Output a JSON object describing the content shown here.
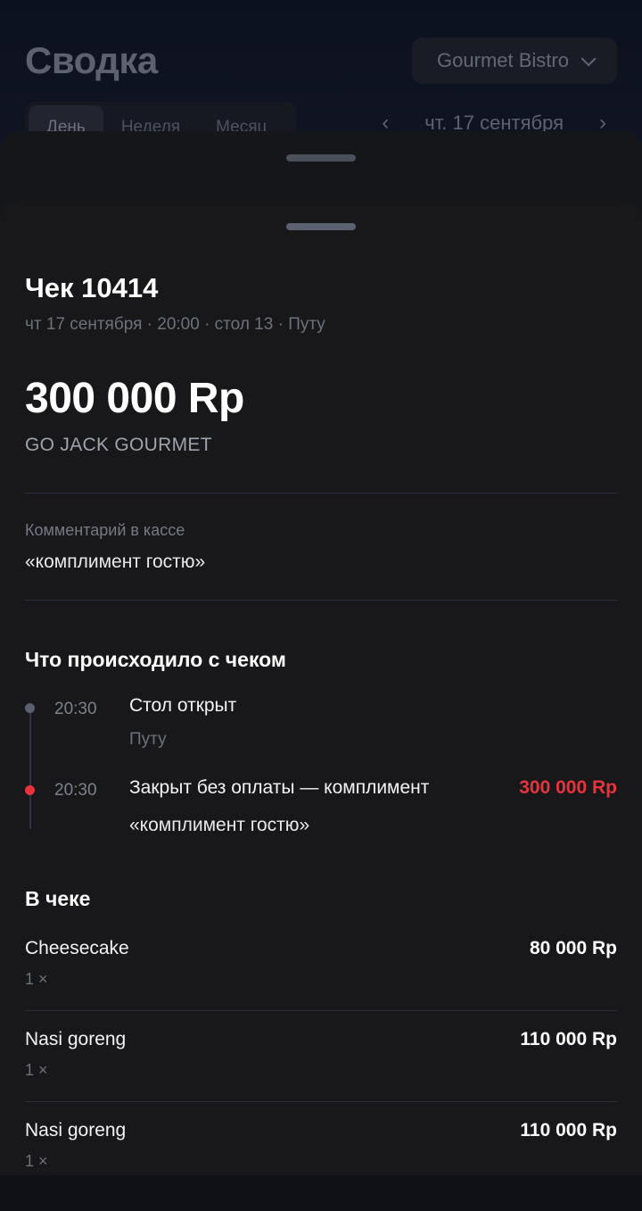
{
  "background": {
    "title": "Сводка",
    "venue": "Gourmet Bistro",
    "tabs": [
      "День",
      "Неделя",
      "Месяц"
    ],
    "active_tab": "День",
    "date": "чт. 17 сентября"
  },
  "check": {
    "title": "Чек 10414",
    "meta": "чт 17 сентября · 20:00 · стол 13 · Путу",
    "amount": "300 000 Rp",
    "payment_method": "GO JACK GOURMET",
    "comment_label": "Комментарий в кассе",
    "comment": "«комплимент гостю»"
  },
  "events": {
    "title": "Что происходило с чеком",
    "items": [
      {
        "time": "20:30",
        "title": "Стол открыт",
        "sub": "Путу",
        "amount": "",
        "dot_color": "#5b6070"
      },
      {
        "time": "20:30",
        "title": "Закрыт без оплаты — комплимент",
        "sub": "«комплимент гостю»",
        "amount": "300 000 Rp",
        "dot_color": "#e5343d"
      }
    ]
  },
  "items": {
    "title": "В чеке",
    "list": [
      {
        "name": "Cheesecake",
        "qty": "1 ×",
        "price": "80 000 Rp"
      },
      {
        "name": "Nasi goreng",
        "qty": "1 ×",
        "price": "110 000 Rp"
      },
      {
        "name": "Nasi goreng",
        "qty": "1 ×",
        "price": "110 000 Rp"
      }
    ]
  },
  "colors": {
    "accent_negative": "#e5343d",
    "sheet_bg": "#18181a"
  }
}
